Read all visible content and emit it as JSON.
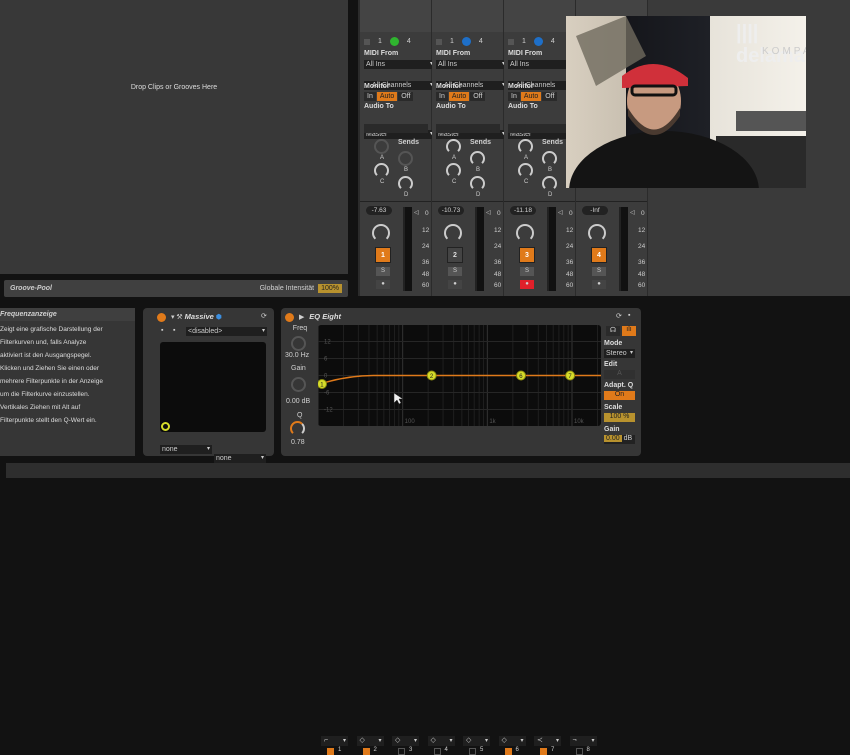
{
  "clip_view": {
    "drop_hint": "Drop Clips or Grooves Here"
  },
  "groove_pool": {
    "title": "Groove-Pool",
    "intensity_label": "Globale Intensität",
    "intensity_value": "100%"
  },
  "mixer": {
    "labels": {
      "midi_from": "MIDI From",
      "monitor": "Monitor",
      "audio_to": "Audio To",
      "sends": "Sends",
      "monitor_in": "In",
      "monitor_auto": "Auto",
      "monitor_off": "Off",
      "send_a": "A",
      "send_b": "B",
      "send_c": "C",
      "send_d": "D",
      "io_1": "1",
      "io_4": "4"
    },
    "meter_scale": [
      "0",
      "12",
      "24",
      "36",
      "48",
      "60"
    ],
    "channels": [
      {
        "input": "All Ins",
        "channel": "All Channels",
        "output": "Master",
        "volume": "-7.63",
        "number": "1",
        "solo": "S",
        "armed": false,
        "active": true,
        "led_color": "#2fb52f"
      },
      {
        "input": "All Ins",
        "channel": "All Channels",
        "output": "Master",
        "volume": "-10.73",
        "number": "2",
        "solo": "S",
        "armed": false,
        "active": false,
        "led_color": "#1e6fc8"
      },
      {
        "input": "All Ins",
        "channel": "All Channels",
        "output": "Master",
        "volume": "-11.18",
        "number": "3",
        "solo": "S",
        "armed": true,
        "active": true,
        "led_color": "#1e6fc8"
      },
      {
        "volume": "-Inf",
        "number": "4",
        "solo": "S",
        "armed": false,
        "active": true
      }
    ]
  },
  "webcam": {
    "logo_text": "delamar",
    "logo_sub": "KOMPAKT"
  },
  "info_panel": {
    "title": "Frequenzanzeige",
    "text": "Zeigt eine grafische Darstellung der\nFilterkurven  und, falls Analyze\naktiviert ist den Ausgangspegel.\nKlicken und Ziehen Sie einen oder\nmehrere Filterpunkte in der Anzeige\num die Filterkurve einzustellen.\nVertikales Ziehen mit Alt auf\nFilterpunkte stellt den Q-Wert ein."
  },
  "massive": {
    "title": "Massive",
    "preset": "<disabled>",
    "macro_a": "none",
    "macro_b": "none"
  },
  "eq_eight": {
    "title": "EQ Eight",
    "freq_label": "Freq",
    "freq_value": "30.0 Hz",
    "gain_label": "Gain",
    "gain_value": "0.00 dB",
    "q_label": "Q",
    "q_value": "0.78",
    "y_ticks": [
      "12",
      "6",
      "0",
      "-6",
      "-12"
    ],
    "x_ticks": [
      "100",
      "1k",
      "10k"
    ],
    "bands": [
      {
        "number": "1",
        "type": "low-cut",
        "on": true
      },
      {
        "number": "2",
        "type": "bell",
        "on": true
      },
      {
        "number": "3",
        "type": "bell",
        "on": false
      },
      {
        "number": "4",
        "type": "bell",
        "on": false
      },
      {
        "number": "5",
        "type": "bell",
        "on": false
      },
      {
        "number": "6",
        "type": "bell",
        "on": true
      },
      {
        "number": "7",
        "type": "notch",
        "on": true
      },
      {
        "number": "8",
        "type": "high-cut",
        "on": false
      }
    ],
    "points": [
      {
        "label": "1"
      },
      {
        "label": "2"
      },
      {
        "label": "6"
      },
      {
        "label": "7"
      }
    ],
    "mode_label": "Mode",
    "mode_value": "Stereo",
    "edit_label": "Edit",
    "edit_value": "A",
    "adapt_q_label": "Adapt. Q",
    "adapt_q_value": "On",
    "scale_label": "Scale",
    "scale_value": "100 %",
    "gain_out_label": "Gain",
    "gain_out_value": "0.00",
    "gain_out_unit": "dB"
  },
  "colors": {
    "accent": "#e07a1a",
    "point": "#d6dc2a",
    "armed": "#e0202a"
  }
}
